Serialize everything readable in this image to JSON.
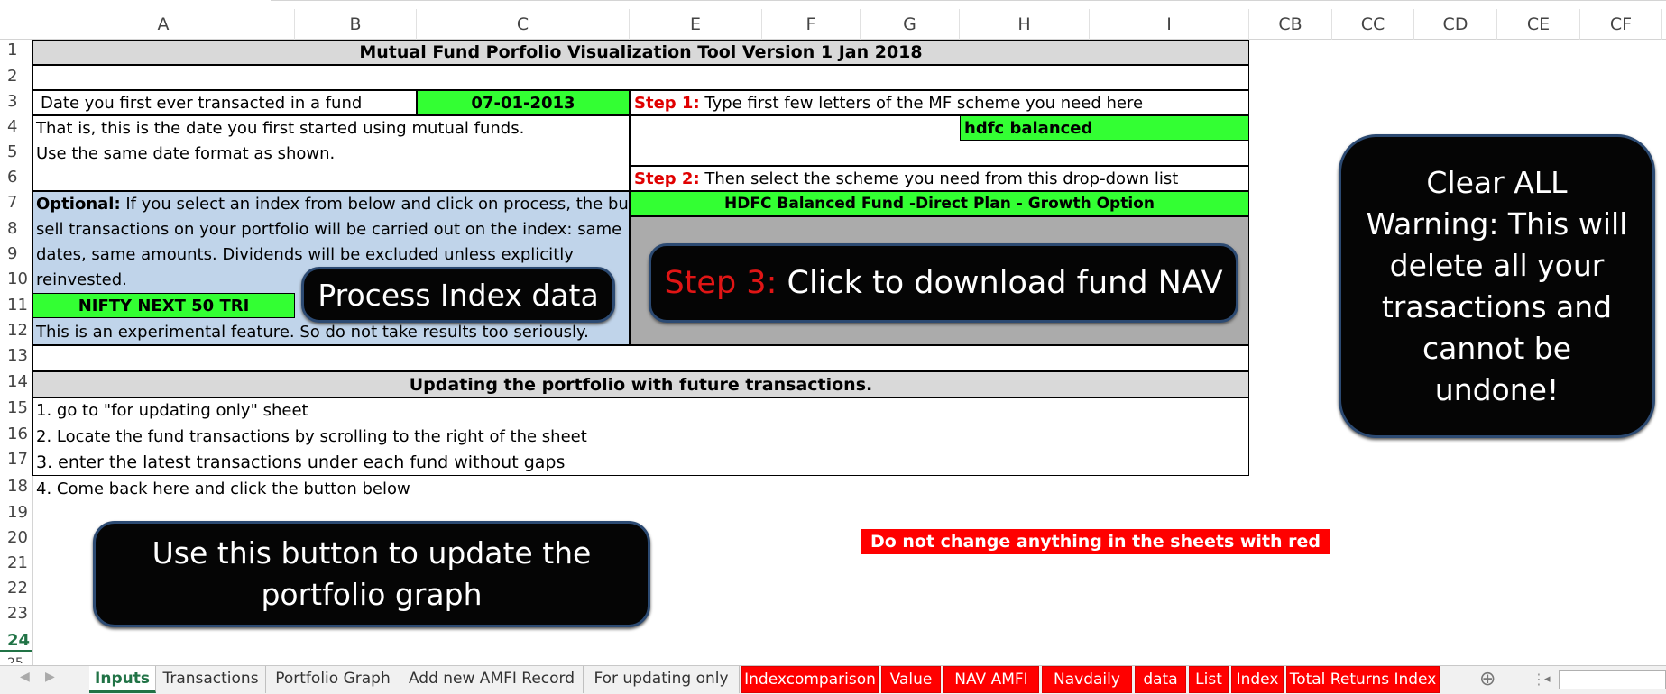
{
  "columns": [
    "A",
    "B",
    "C",
    "E",
    "F",
    "G",
    "H",
    "I",
    "CB",
    "CC",
    "CD",
    "CE",
    "CF"
  ],
  "rows": [
    "1",
    "2",
    "3",
    "4",
    "5",
    "6",
    "7",
    "8",
    "9",
    "10",
    "11",
    "12",
    "13",
    "14",
    "15",
    "16",
    "17",
    "18",
    "19",
    "20",
    "21",
    "22",
    "23",
    "24",
    "25"
  ],
  "sheet": {
    "title": "Mutual Fund Porfolio Visualization Tool Version 1 Jan 2018",
    "first_date_label": "Date you first ever transacted in a fund",
    "first_date_value": "07-01-2013",
    "date_note_1": "That is, this is the date you first started using mutual funds.",
    "date_note_2": "Use the same date format as shown.",
    "step1_label": "Step 1:",
    "step1_text": " Type first few letters of the MF scheme you need here",
    "search_value": "hdfc balanced",
    "step2_label": "Step 2:",
    "step2_text": " Then select the scheme you need from this drop-down list",
    "scheme_value": "HDFC Balanced Fund -Direct Plan - Growth Option",
    "optional_label": "Optional:",
    "optional_text_1": " If you select an index from below and click on process, the buy and",
    "optional_text_2": "sell transactions on your portfolio will be carried out on the index: same",
    "optional_text_3": "dates, same amounts. Dividends will be excluded unless explicitly",
    "optional_text_4": "reinvested.",
    "index_value": "NIFTY NEXT 50 TRI",
    "experimental_note": "This is an experimental feature. So do not take results too seriously.",
    "update_header": "Updating the portfolio with future transactions.",
    "update_step_1": "1. go to \"for updating only\" sheet",
    "update_step_2": "2. Locate the fund transactions by scrolling to the right of the sheet",
    "update_step_3": "3. enter the latest transactions under each fund without gaps",
    "update_step_4": "4. Come back here and click the button below",
    "warning_text": "Do not change anything in the sheets with red tabs!"
  },
  "buttons": {
    "process_index": "Process Index data",
    "download_step_label": "Step 3:",
    "download_text": " Click to download fund NAV",
    "clear_all_line1": "Clear ALL",
    "clear_all_line2": "Warning: This will",
    "clear_all_line3": "delete all your",
    "clear_all_line4": "trasactions and",
    "clear_all_line5": "cannot be",
    "clear_all_line6": "undone!",
    "update_graph_line1": "Use this button to update the",
    "update_graph_line2": "portfolio graph"
  },
  "tabs": [
    {
      "label": "Inputs",
      "state": "active"
    },
    {
      "label": "Transactions",
      "state": "normal"
    },
    {
      "label": "Portfolio Graph",
      "state": "normal"
    },
    {
      "label": "Add new AMFI Record",
      "state": "normal"
    },
    {
      "label": "For updating only",
      "state": "normal"
    },
    {
      "label": "Indexcomparison",
      "state": "red"
    },
    {
      "label": "Value",
      "state": "red"
    },
    {
      "label": "NAV AMFI",
      "state": "red"
    },
    {
      "label": "Navdaily",
      "state": "red"
    },
    {
      "label": "data",
      "state": "red"
    },
    {
      "label": "List",
      "state": "red"
    },
    {
      "label": "Index",
      "state": "red"
    },
    {
      "label": "Total Returns Index",
      "state": "red"
    }
  ],
  "colors": {
    "green_fill": "#33ff33",
    "gray_fill": "#d9d9d9",
    "blue_fill": "#c0d4ea",
    "red_tab": "#ff0000",
    "step_red": "#e00000",
    "excel_green": "#217346"
  }
}
